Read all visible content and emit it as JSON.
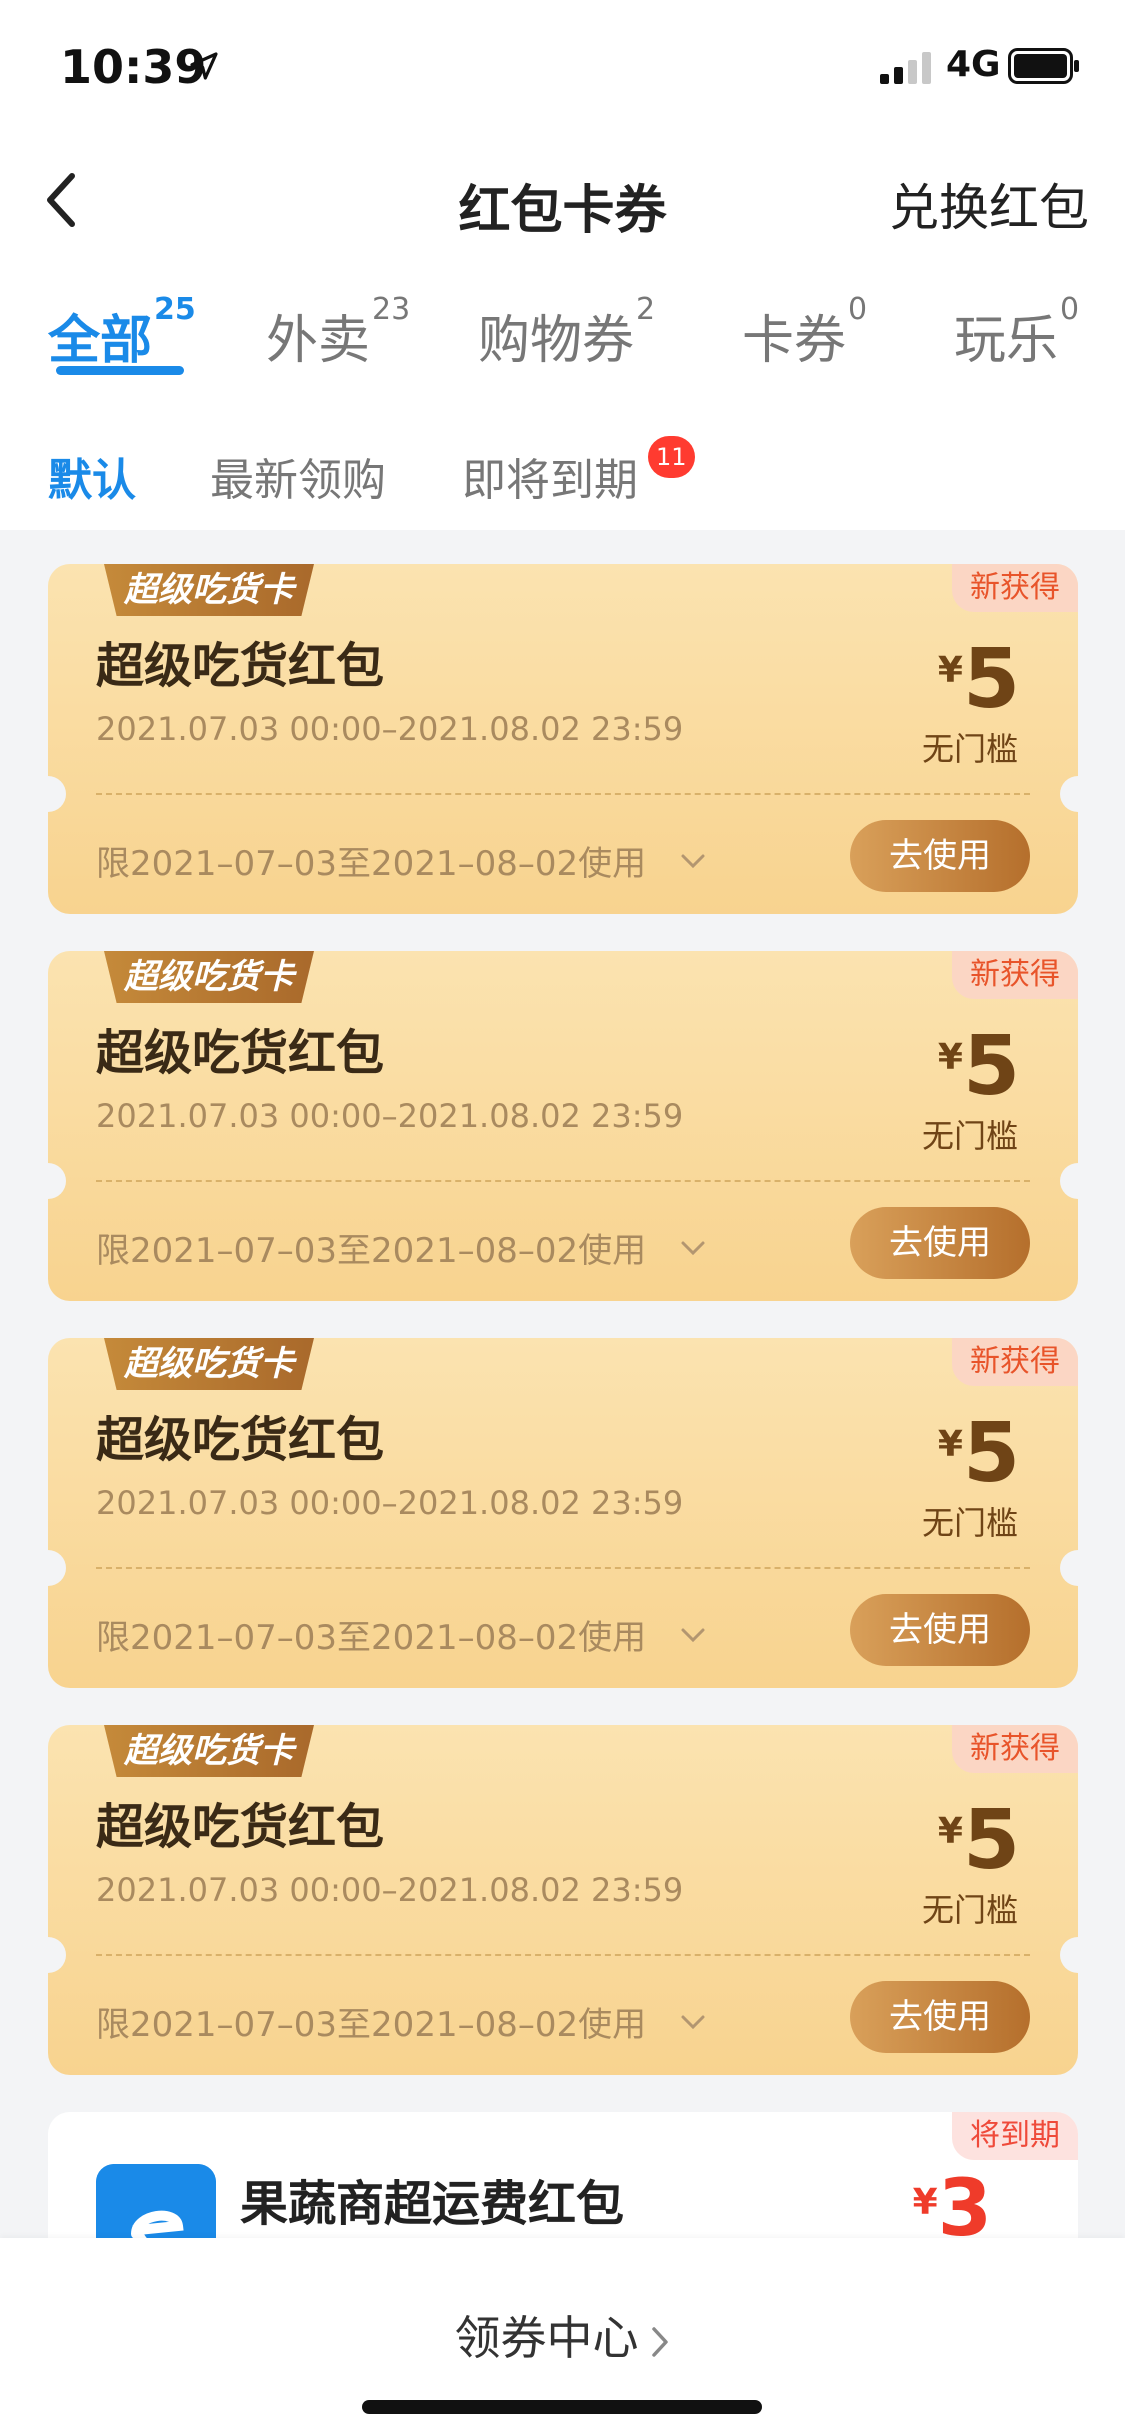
{
  "status_bar": {
    "time": "10:39",
    "network": "4G"
  },
  "nav": {
    "title": "红包卡券",
    "right_action": "兑换红包"
  },
  "tabs": [
    {
      "label": "全部",
      "count": "25"
    },
    {
      "label": "外卖",
      "count": "23"
    },
    {
      "label": "购物券",
      "count": "2"
    },
    {
      "label": "卡券",
      "count": "0"
    },
    {
      "label": "玩乐",
      "count": "0"
    }
  ],
  "subtabs": {
    "default": "默认",
    "latest": "最新领购",
    "expiring": "即将到期",
    "expiring_badge": "11"
  },
  "coupons": [
    {
      "tag": "超级吃货卡",
      "new_label": "新获得",
      "title": "超级吃货红包",
      "date": "2021.07.03 00:00–2021.08.02 23:59",
      "currency": "¥",
      "amount": "5",
      "threshold": "无门槛",
      "limit": "限2021–07–03至2021–08–02使用",
      "button": "去使用"
    },
    {
      "tag": "超级吃货卡",
      "new_label": "新获得",
      "title": "超级吃货红包",
      "date": "2021.07.03 00:00–2021.08.02 23:59",
      "currency": "¥",
      "amount": "5",
      "threshold": "无门槛",
      "limit": "限2021–07–03至2021–08–02使用",
      "button": "去使用"
    },
    {
      "tag": "超级吃货卡",
      "new_label": "新获得",
      "title": "超级吃货红包",
      "date": "2021.07.03 00:00–2021.08.02 23:59",
      "currency": "¥",
      "amount": "5",
      "threshold": "无门槛",
      "limit": "限2021–07–03至2021–08–02使用",
      "button": "去使用"
    },
    {
      "tag": "超级吃货卡",
      "new_label": "新获得",
      "title": "超级吃货红包",
      "date": "2021.07.03 00:00–2021.08.02 23:59",
      "currency": "¥",
      "amount": "5",
      "threshold": "无门槛",
      "limit": "限2021–07–03至2021–08–02使用",
      "button": "去使用"
    }
  ],
  "partial_coupon": {
    "expire_label": "将到期",
    "title": "果蔬商超运费红包",
    "currency": "¥",
    "amount": "3"
  },
  "bottom": {
    "center_label": "领券中心"
  },
  "colors": {
    "accent": "#1a8ae8",
    "badge": "#ff3b30",
    "coupon_bg": "#f8d38f",
    "button": "#b56f2c",
    "red_amount": "#ef3b2a"
  }
}
